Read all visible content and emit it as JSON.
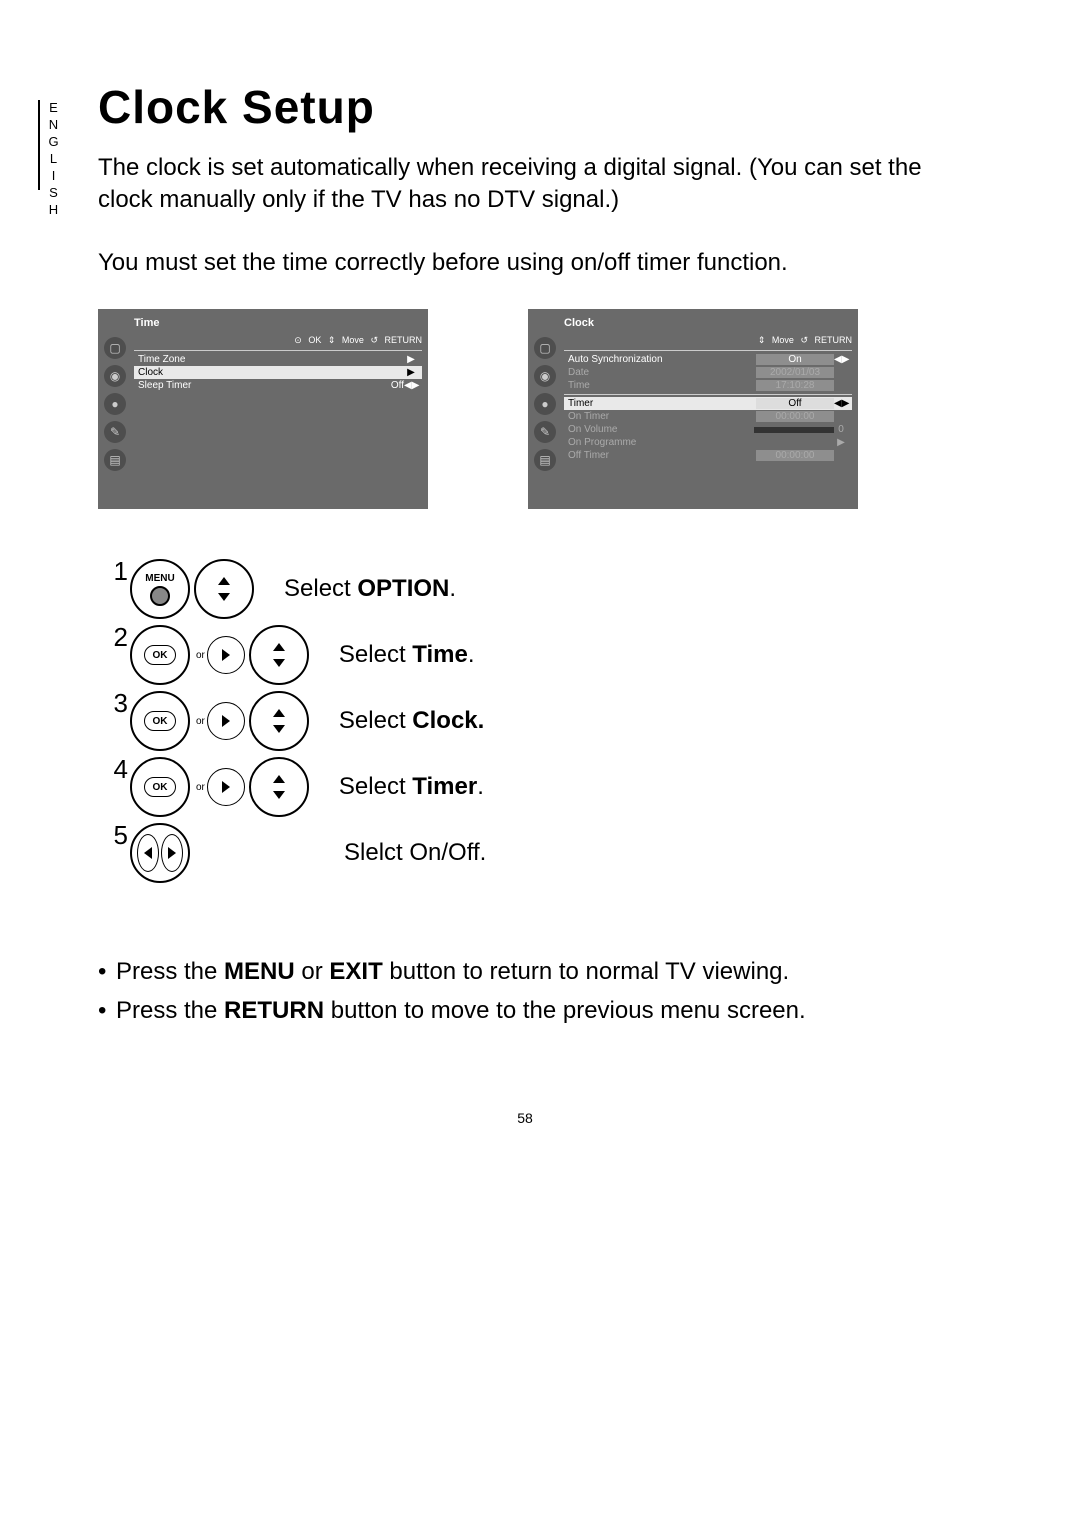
{
  "lang_tab": "ENGLISH",
  "title": "Clock Setup",
  "intro": "The clock is set automatically when receiving a digital signal. (You can set the clock manually only if the TV has no DTV signal.)",
  "subintro": "You must set the time correctly before using on/off timer function.",
  "menu_time": {
    "title": "Time",
    "hints": {
      "ok": "OK",
      "move": "Move",
      "return": "RETURN"
    },
    "rows": [
      {
        "label": "Time Zone",
        "value": "",
        "arrow": "▶"
      },
      {
        "label": "Clock",
        "value": "",
        "arrow": "▶",
        "selected": true
      },
      {
        "label": "Sleep Timer",
        "value": "Off",
        "arrow": "◀▶"
      }
    ]
  },
  "menu_clock": {
    "title": "Clock",
    "hints": {
      "move": "Move",
      "return": "RETURN"
    },
    "rows": [
      {
        "label": "Auto Synchronization",
        "value": "On",
        "arrow": "◀▶"
      },
      {
        "label": "Date",
        "value": "2002/01/03",
        "dim": true
      },
      {
        "label": "Time",
        "value": "17:10:28",
        "dim": true
      }
    ],
    "divider": true,
    "rows2": [
      {
        "label": "Timer",
        "value": "Off",
        "arrow": "◀▶",
        "selected": true
      },
      {
        "label": "On Timer",
        "value": "00:00:00",
        "dim": true
      },
      {
        "label": "On Volume",
        "slider": true,
        "value": "0",
        "dim": true
      },
      {
        "label": "On Programme",
        "value": "",
        "arrow": "▶",
        "dim": true
      },
      {
        "label": "Off Timer",
        "value": "00:00:00",
        "dim": true
      }
    ]
  },
  "remote_labels": {
    "menu": "MENU",
    "ok": "OK",
    "or": "or"
  },
  "steps": [
    {
      "num": "1",
      "icons": [
        "menu",
        "updown"
      ],
      "text_pre": "Select ",
      "bold": "OPTION",
      "text_post": "."
    },
    {
      "num": "2",
      "icons": [
        "ok",
        "or",
        "right",
        "updown"
      ],
      "text_pre": "Select ",
      "bold": "Time",
      "text_post": "."
    },
    {
      "num": "3",
      "icons": [
        "ok",
        "or",
        "right",
        "updown"
      ],
      "text_pre": "Select ",
      "bold": "Clock.",
      "text_post": ""
    },
    {
      "num": "4",
      "icons": [
        "ok",
        "or",
        "right",
        "updown"
      ],
      "text_pre": "Select ",
      "bold": "Timer",
      "text_post": "."
    },
    {
      "num": "5",
      "icons": [
        "leftright"
      ],
      "text_pre": "Slelct On/Off.",
      "bold": "",
      "text_post": ""
    }
  ],
  "notes": [
    {
      "pre": "Press the ",
      "b1": "MENU",
      "mid": " or ",
      "b2": "EXIT",
      "post": " button to return to normal TV viewing."
    },
    {
      "pre": "Press the ",
      "b1": "RETURN",
      "mid": "",
      "b2": "",
      "post": " button to move to the previous menu screen."
    }
  ],
  "page_number": "58"
}
